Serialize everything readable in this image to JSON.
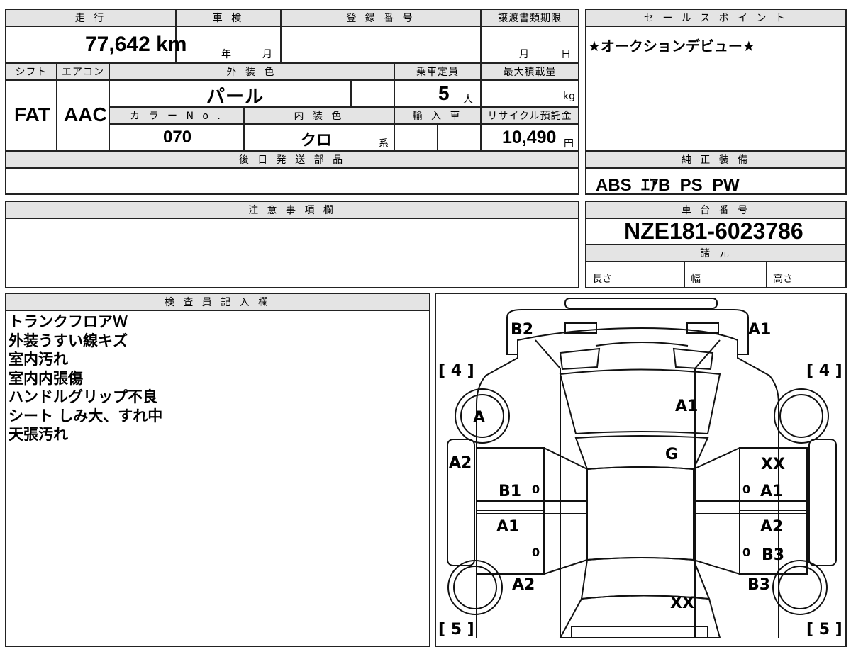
{
  "main_table": {
    "mileage_header": "走 行",
    "mileage_value": "77,642 km",
    "inspection_header": "車 検",
    "inspection_year_unit": "年",
    "inspection_month_unit": "月",
    "registration_header": "登 録 番 号",
    "transfer_deadline_header": "譲渡書類期限",
    "transfer_month_unit": "月",
    "transfer_day_unit": "日",
    "shift_header": "シフト",
    "shift_value": "FAT",
    "ac_header": "エアコン",
    "ac_value": "AAC",
    "exterior_color_header": "外 装 色",
    "exterior_color_value": "パ ー ル",
    "capacity_header": "乗車定員",
    "capacity_value": "5",
    "capacity_unit": "人",
    "max_load_header": "最大積載量",
    "max_load_unit": "kg",
    "color_no_header": "カ ラ ー  N o .",
    "color_no_value": "070",
    "interior_color_header": "内 装 色",
    "interior_color_value": "ク ロ",
    "interior_color_suffix": "系",
    "import_header": "輸 入 車",
    "recycle_fee_header": "リサイクル預託金",
    "recycle_fee_value": "10,490",
    "recycle_fee_unit": "円",
    "parts_header": "後 日 発 送 部 品"
  },
  "sales_point": {
    "header": "セ ー ル ス ポ イ ン ト",
    "text": "★オークションデビュー★"
  },
  "genuine_equipment": {
    "header": "純 正 装 備",
    "text": "ABS  ｴｱB  PS  PW"
  },
  "notes": {
    "header": "注 意 事 項 欄"
  },
  "chassis": {
    "header": "車 台 番 号",
    "number": "NZE181-6023786",
    "specs_header": "諸 元",
    "length_label": "長さ",
    "width_label": "幅",
    "height_label": "高さ"
  },
  "inspector": {
    "header": "検 査 員 記 入 欄",
    "remarks": [
      "トランクフロアＷ",
      "外装うすい線キズ",
      "室内汚れ",
      "室内内張傷",
      "ハンドルグリップ不良",
      "シート しみ大、すれ中",
      "天張汚れ"
    ]
  },
  "diagram": {
    "tire_rear_left": "[ 4 ]",
    "tire_rear_right": "[ 4 ]",
    "tire_front_left": "[ 5 ]",
    "tire_front_right": "[ 5 ]",
    "rear_bumper_left": "B2",
    "rear_bumper_right": "A1",
    "trunk": "A1",
    "rear_glass": "G",
    "rear_left_wheel": "A",
    "left_quarter": "A2",
    "left_rear_door": "B1",
    "left_rear_door_mark": "0",
    "left_front_door": "A1",
    "left_front_door_mark": "0",
    "left_front_fender": "A2",
    "right_quarter": "XX",
    "right_rear_door": "A1",
    "right_rear_door_mark": "0",
    "right_front_door_top": "A2",
    "right_front_door": "B3",
    "right_front_door_mark": "0",
    "right_front_fender": "B3",
    "hood": "XX"
  }
}
